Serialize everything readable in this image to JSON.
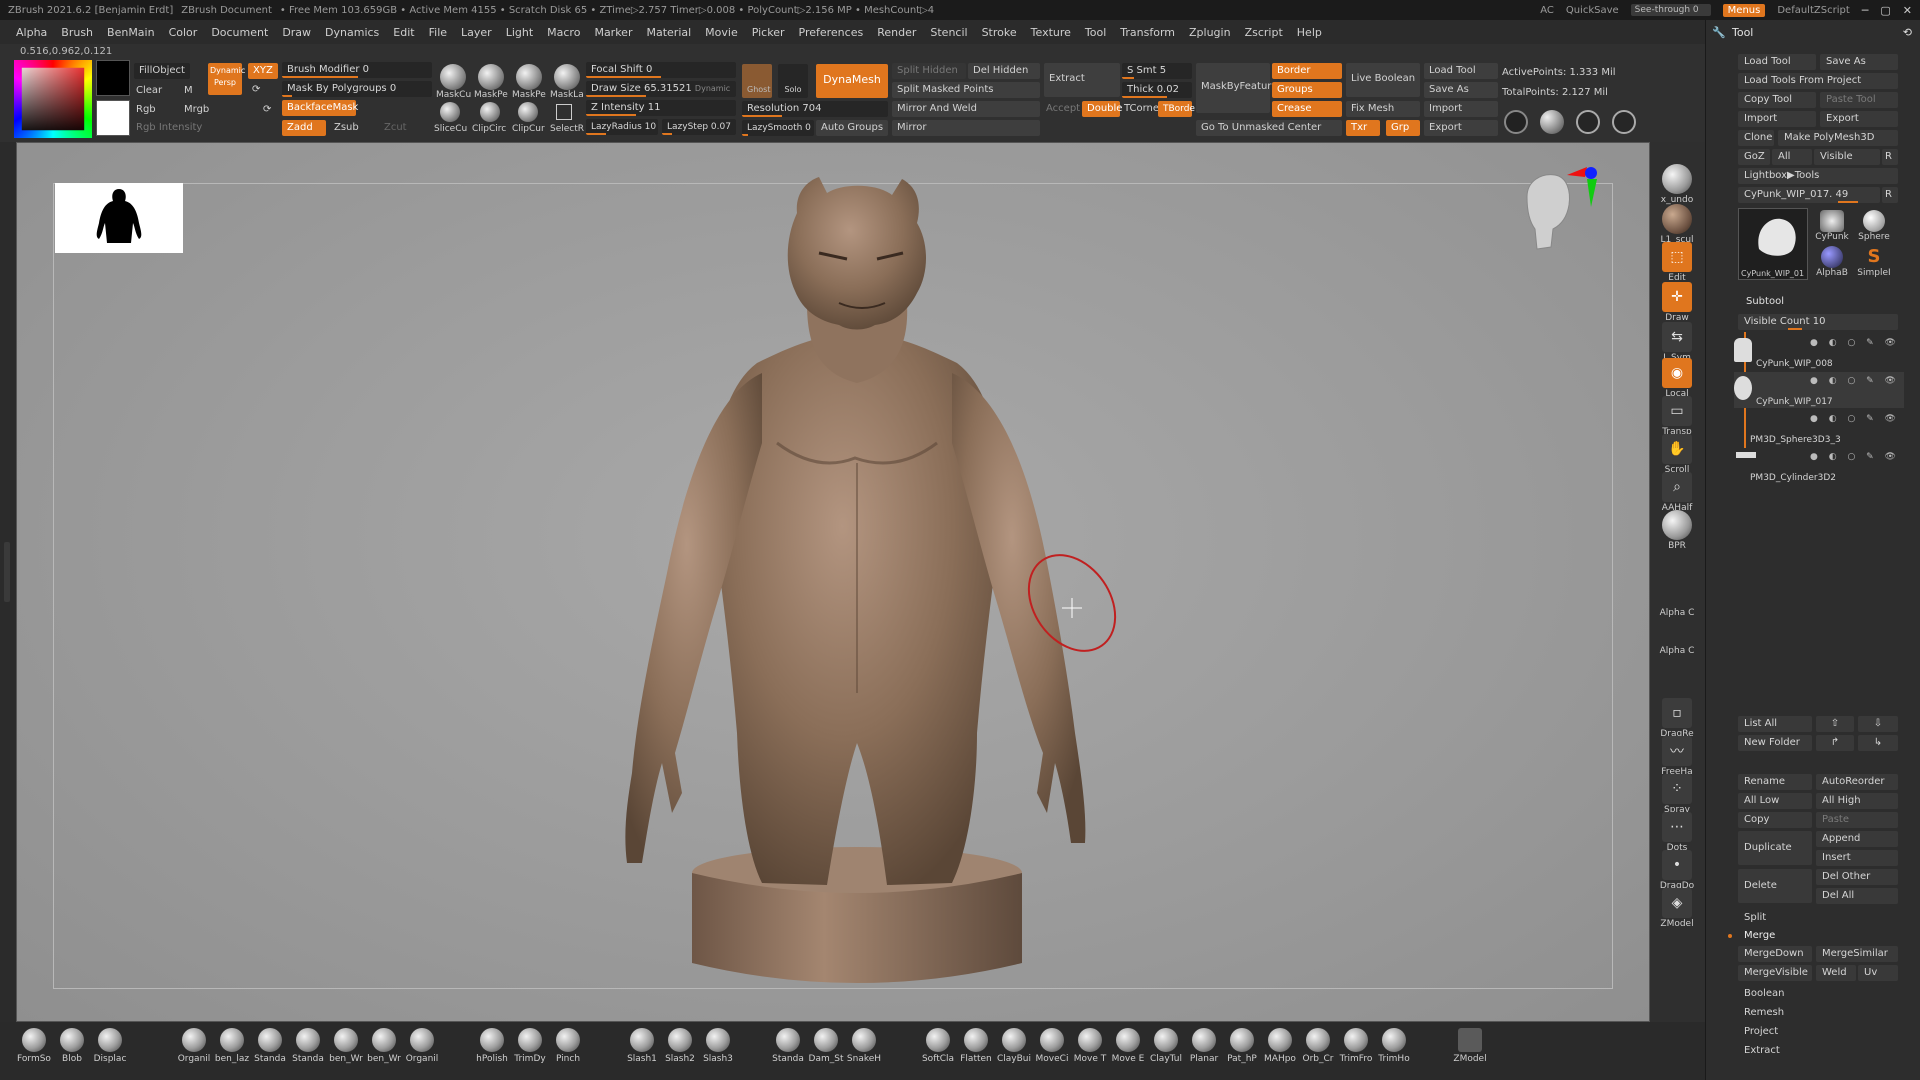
{
  "titlebar": {
    "app": "ZBrush 2021.6.2 [Benjamin Erdt]",
    "doc": "ZBrush Document",
    "stats": "• Free Mem 103.659GB • Active Mem 4155 • Scratch Disk 65 • ZTime▷2.757 Timer▷0.008 • PolyCount▷2.156 MP • MeshCount▷4",
    "ac": "AC",
    "quicksave": "QuickSave",
    "seethrough": "See-through  0",
    "menus": "Menus",
    "script": "DefaultZScript"
  },
  "menubar": [
    "Alpha",
    "Brush",
    "BenMain",
    "Color",
    "Document",
    "Draw",
    "Dynamics",
    "Edit",
    "File",
    "Layer",
    "Light",
    "Macro",
    "Marker",
    "Material",
    "Movie",
    "Picker",
    "Preferences",
    "Render",
    "Stencil",
    "Stroke",
    "Texture",
    "Tool",
    "Transform",
    "Zplugin",
    "Zscript",
    "Help"
  ],
  "coord": "0.516,0.962,0.121",
  "shelf": {
    "fillobject": "FillObject",
    "clear": "Clear",
    "m": "M",
    "rgb": "Rgb",
    "mrgb": "Mrgb",
    "rgb_intensity": "Rgb Intensity",
    "dynamic": "Dynamic",
    "persp": "Persp",
    "xyz": "XYZ",
    "brush_modifier": "Brush Modifier 0",
    "mask_polygroups": "Mask By Polygroups 0",
    "backfacemask": "BackfaceMask",
    "zadd": "Zadd",
    "zsub": "Zsub",
    "zcut": "Zcut",
    "brushes": [
      "MaskCu",
      "MaskPe",
      "MaskPe",
      "MaskLa",
      "SliceCu",
      "ClipCirc",
      "ClipCur",
      "SelectR"
    ],
    "focal_shift": "Focal Shift 0",
    "draw_size_label": "Draw Size",
    "draw_size_value": "65.31521",
    "dynamic_small": "Dynamic",
    "z_intensity": "Z Intensity 11",
    "lazyradius": "LazyRadius 10",
    "lazystep": "LazyStep 0.07",
    "ghost": "Ghost",
    "solo": "Solo",
    "dynamesh": "DynaMesh",
    "resolution": "Resolution 704",
    "lazysmooth": "LazySmooth 0",
    "split_hidden": "Split Hidden",
    "del_hidden": "Del Hidden",
    "split_masked": "Split Masked Points",
    "mirror_weld": "Mirror And Weld",
    "mirror": "Mirror",
    "auto_groups": "Auto Groups",
    "extract": "Extract",
    "accept": "Accept",
    "double": "Double",
    "s_smt": "S Smt 5",
    "thick": "Thick 0.02",
    "tcorne": "TCorne",
    "tborder": "TBorde",
    "maskbyfeature": "MaskByFeatur",
    "border": "Border",
    "groups": "Groups",
    "crease": "Crease",
    "go_unmasked": "Go To Unmasked Center",
    "live_boolean": "Live Boolean",
    "fix_mesh": "Fix Mesh",
    "txr": "Txr",
    "grp": "Grp",
    "load_tool": "Load Tool",
    "save_as": "Save As",
    "import": "Import",
    "export": "Export",
    "active_points": "ActivePoints: 1.333 Mil",
    "total_points": "TotalPoints: 2.127 Mil"
  },
  "rstrip": [
    "x_undo",
    "L1_scul",
    "Edit",
    "Draw",
    "L.Sym",
    "Local",
    "Transp",
    "Scroll",
    "AAHalf",
    "BPR",
    "Alpha C",
    "Alpha C",
    "DragRe",
    "FreeHa",
    "Spray",
    "Dots",
    "DragDo",
    "ZModel"
  ],
  "bottom": [
    "FormSo",
    "Blob",
    "Displac",
    "Organil",
    "ben_laz",
    "Standa",
    "Standa",
    "ben_Wr",
    "ben_Wr",
    "Organil",
    "hPolish",
    "TrimDy",
    "Pinch",
    "Slash1",
    "Slash2",
    "Slash3",
    "Standa",
    "Dam_St",
    "SnakeH",
    "SoftCla",
    "Flatten",
    "ClayBui",
    "MoveCi",
    "Move T",
    "Move E",
    "ClayTul",
    "Planar",
    "Pat_hP",
    "MAHpo",
    "Orb_Cr",
    "TrimFro",
    "TrimHo",
    "ZModel"
  ],
  "tool": {
    "title": "Tool",
    "load_tool": "Load Tool",
    "save_as": "Save As",
    "load_project": "Load Tools From Project",
    "copy_tool": "Copy Tool",
    "paste_tool": "Paste Tool",
    "import": "Import",
    "export": "Export",
    "clone": "Clone",
    "make_polymesh": "Make PolyMesh3D",
    "goz": "GoZ",
    "all": "All",
    "visible": "Visible",
    "r": "R",
    "lightbox": "Lightbox▶Tools",
    "current": "CyPunk_WIP_017. 49",
    "thumbs": [
      "CyPunk_WIP_01",
      "CyPunk",
      "Sphere",
      "AlphaB",
      "SimpleI"
    ],
    "subtool_header": "Subtool",
    "visible_count": "Visible Count 10",
    "subtools": [
      "CyPunk_WIP_008",
      "CyPunk_WIP_017",
      "PM3D_Sphere3D3_3",
      "PM3D_Cylinder3D2"
    ],
    "list_all": "List All",
    "new_folder": "New Folder",
    "rename": "Rename",
    "autoreorder": "AutoReorder",
    "all_low": "All Low",
    "all_high": "All High",
    "copy": "Copy",
    "paste": "Paste",
    "append": "Append",
    "duplicate": "Duplicate",
    "insert": "Insert",
    "delete": "Delete",
    "del_other": "Del Other",
    "del_all": "Del All",
    "split": "Split",
    "merge": "Merge",
    "mergedown": "MergeDown",
    "mergesimilar": "MergeSimilar",
    "mergevisible": "MergeVisible",
    "weld": "Weld",
    "uv": "Uv",
    "boolean": "Boolean",
    "remesh": "Remesh",
    "project": "Project",
    "extract": "Extract"
  },
  "colors": {
    "accent": "#e0761e",
    "panel": "#2d2d2d",
    "viewport": "#9b9b9b",
    "sculpt": "#8a6e58"
  }
}
